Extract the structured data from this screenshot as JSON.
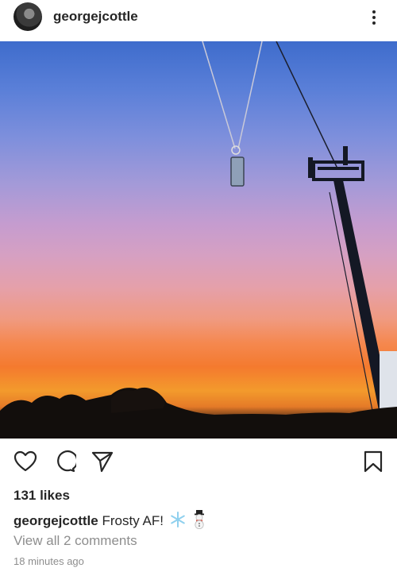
{
  "post": {
    "username": "georgejcottle",
    "likes": "131 likes",
    "caption_user": "georgejcottle",
    "caption_text": "Frosty AF!",
    "caption_emojis": [
      "snowflake-icon",
      "snowman-icon"
    ],
    "view_comments": "View all 2 comments",
    "timestamp": "18 minutes ago"
  },
  "icons": {
    "more": "more-options-icon",
    "like": "heart-icon",
    "comment": "comment-icon",
    "share": "share-icon",
    "save": "bookmark-icon"
  },
  "colors": {
    "text": "#262626",
    "muted": "#8e8e8e",
    "sky_top": "#3e6ccc",
    "sunset": "#f47a2e"
  }
}
